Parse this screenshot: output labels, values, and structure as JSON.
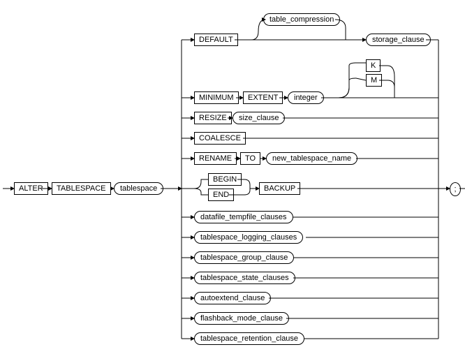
{
  "stem": {
    "alter": "ALTER",
    "tablespace_kw": "TABLESPACE",
    "tablespace_nt": "tablespace"
  },
  "branches": {
    "default_kw": "DEFAULT",
    "table_compression": "table_compression",
    "storage_clause": "storage_clause",
    "minimum": "MINIMUM",
    "extent": "EXTENT",
    "integer": "integer",
    "k": "K",
    "m": "M",
    "resize": "RESIZE",
    "size_clause": "size_clause",
    "coalesce": "COALESCE",
    "rename": "RENAME",
    "to": "TO",
    "new_tablespace_name": "new_tablespace_name",
    "begin": "BEGIN",
    "end": "END",
    "backup": "BACKUP",
    "datafile_tempfile_clauses": "datafile_tempfile_clauses",
    "tablespace_logging_clauses": "tablespace_logging_clauses",
    "tablespace_group_clause": "tablespace_group_clause",
    "tablespace_state_clauses": "tablespace_state_clauses",
    "autoextend_clause": "autoextend_clause",
    "flashback_mode_clause": "flashback_mode_clause",
    "tablespace_retention_clause": "tablespace_retention_clause"
  },
  "terminator": ";"
}
